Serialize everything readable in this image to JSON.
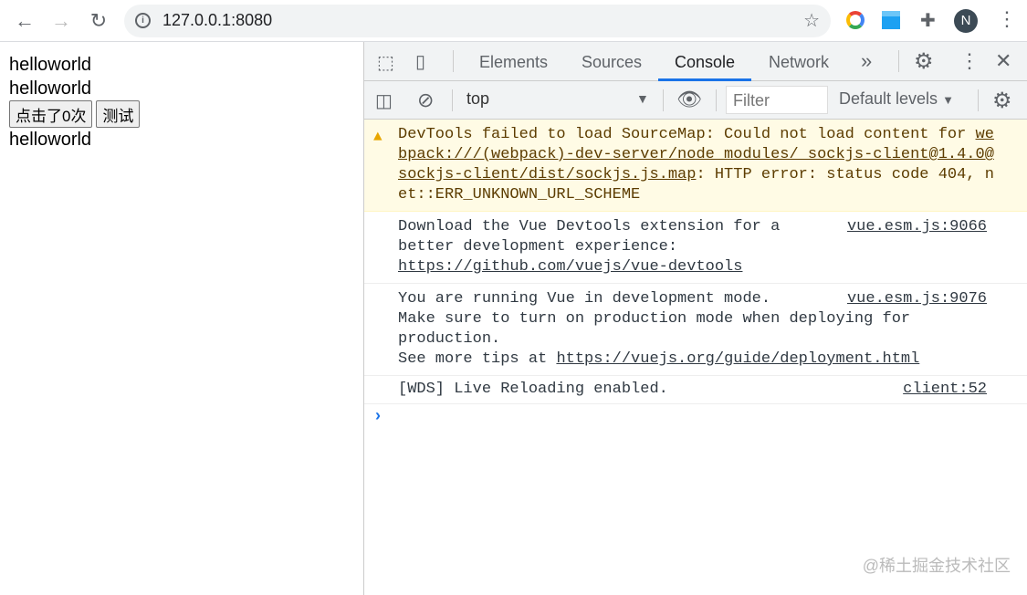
{
  "browser": {
    "url": "127.0.0.1:8080",
    "avatar_letter": "N"
  },
  "page": {
    "line1": "helloworld",
    "line2": "helloworld",
    "button_click": "点击了0次",
    "button_test": "测试",
    "line3": "helloworld"
  },
  "devtools": {
    "tabs": [
      "Elements",
      "Sources",
      "Console",
      "Network"
    ],
    "active_tab": "Console",
    "context": "top",
    "filter_placeholder": "Filter",
    "levels": "Default levels",
    "messages": [
      {
        "type": "warning",
        "text": "DevTools failed to load SourceMap: Could not load content for ",
        "link": "webpack:///(webpack)-dev-server/node_modules/_sockjs-client@1.4.0@sockjs-client/dist/sockjs.js.map",
        "tail": ": HTTP error: status code 404, net::ERR_UNKNOWN_URL_SCHEME"
      },
      {
        "type": "log",
        "text": "Download the Vue Devtools extension for a\nbetter development experience:\n",
        "link": "https://github.com/vuejs/vue-devtools",
        "source": "vue.esm.js:9066"
      },
      {
        "type": "log",
        "text": "You are running Vue in development mode.\nMake sure to turn on production mode when deploying for\nproduction.\nSee more tips at ",
        "link": "https://vuejs.org/guide/deployment.html",
        "source": "vue.esm.js:9076"
      },
      {
        "type": "log",
        "text": "[WDS] Live Reloading enabled.",
        "source": "client:52"
      }
    ]
  },
  "watermark": "@稀土掘金技术社区"
}
